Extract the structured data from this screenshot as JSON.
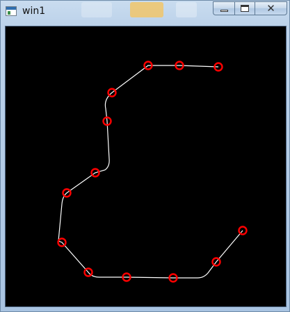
{
  "window": {
    "title": "win1",
    "icon": "opencv-window-icon"
  },
  "caption_buttons": {
    "minimize_icon": "minimize-icon",
    "maximize_icon": "maximize-icon",
    "close_icon": "close-icon"
  },
  "canvas": {
    "background": "#000000",
    "curve_color": "#ffffff",
    "marker_color": "#ff0000",
    "marker_shape": "circle",
    "point_count": 13
  }
}
